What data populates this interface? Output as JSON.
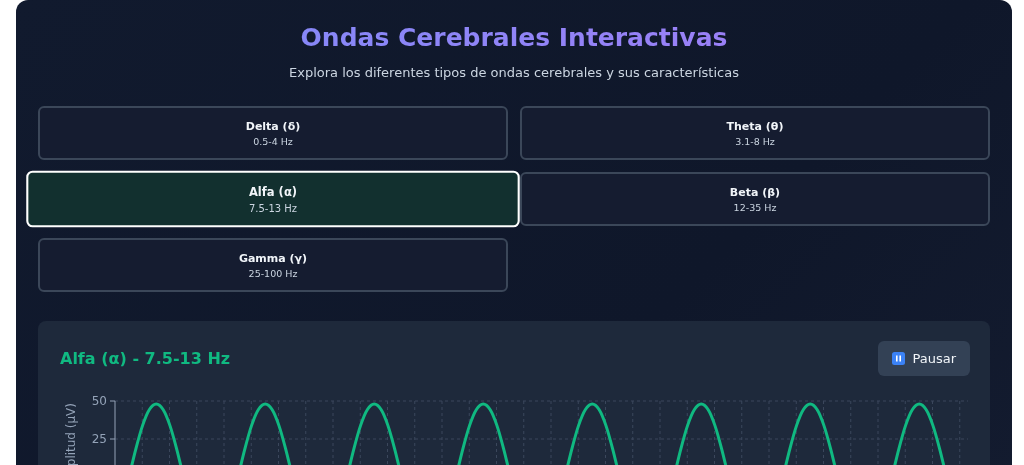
{
  "header": {
    "title": "Ondas Cerebrales Interactivas",
    "subtitle": "Explora los diferentes tipos de ondas cerebrales y sus características"
  },
  "waves": [
    {
      "name": "Delta (δ)",
      "range": "0.5-4 Hz",
      "selected": false
    },
    {
      "name": "Theta (θ)",
      "range": "3.1-8 Hz",
      "selected": false
    },
    {
      "name": "Alfa (α)",
      "range": "7.5-13 Hz",
      "selected": true
    },
    {
      "name": "Beta (β)",
      "range": "12-35 Hz",
      "selected": false
    },
    {
      "name": "Gamma (γ)",
      "range": "25-100 Hz",
      "selected": false
    }
  ],
  "viewer": {
    "title": "Alfa (α) - 7.5-13 Hz",
    "pause_button": "Pausar",
    "y_axis": {
      "label": "plitud (μV)",
      "ticks": [
        "50",
        "25"
      ]
    }
  }
}
